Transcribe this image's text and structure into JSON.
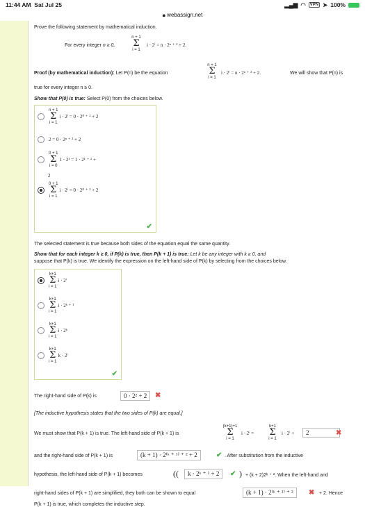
{
  "status": {
    "time": "11:44 AM",
    "date": "Sat Jul 25",
    "battery": "100%",
    "vpn": "VPN"
  },
  "url": "webassign.net",
  "prompt": "Prove the following statement by mathematical induction.",
  "statement": {
    "intro": "For every integer",
    "cond": "n ≥ 0,",
    "sum_top": "n + 1",
    "sum_bot": "i = 1",
    "body": "i · 2ⁱ = n · 2ⁿ ⁺ ² + 2."
  },
  "proof": {
    "heading": "Proof (by mathematical induction):",
    "text1": "Let P(n) be the equation",
    "eq": "i · 2ⁱ = n · 2ⁿ ⁺ ² + 2.",
    "text2": "We will show that P(n) is",
    "line2": "true for every integer n ≥ 0."
  },
  "p0": {
    "heading": "Show that P(0) is true:",
    "text": "Select P(0) from the choices below."
  },
  "p0_options": [
    {
      "top": "n + 1",
      "bot": "i = 1",
      "expr": "i · 2ⁱ = 0 · 2⁰ ⁺ ² + 2"
    },
    {
      "expr": "2 = 0 · 2ⁿ ⁺ ² + 2"
    },
    {
      "top": "0 + 1",
      "bot": "i = 0",
      "expr": "1 · 2¹ = 1 · 2¹ ⁺ ² +",
      "extra": "2"
    },
    {
      "top": "0 + 1",
      "bot": "i = 1",
      "expr": "i · 2ⁱ = 0 · 2⁰ ⁺ ² + 2"
    }
  ],
  "truth": "The selected statement is true because both sides of the equation equal the same quantity.",
  "pk": {
    "heading": "Show that for each integer k ≥ 0, if P(k) is true, then P(k + 1) is true:",
    "text": "Let k be any integer with k ≥ 0, and",
    "line2": "suppose that P(k) is true. We identify the expression on the left-hand side of P(k) by selecting from the choices below."
  },
  "pk_options": [
    {
      "top": "k+1",
      "bot": "i = 1",
      "expr": "i · 2ⁱ"
    },
    {
      "top": "k+1",
      "bot": "i = 1",
      "expr": "i · 2ᵏ ⁺ ¹"
    },
    {
      "top": "k+1",
      "bot": "i = 1",
      "expr": "i · 2ᵏ"
    },
    {
      "top": "k+1",
      "bot": "i = 1",
      "expr": "k · 2ⁱ"
    }
  ],
  "rhs": {
    "label": "The right-hand side of P(k) is",
    "value": "0 · 2² + 2"
  },
  "hypothesis": "[The inductive hypothesis states that the two sides of P(k) are equal.]",
  "lhs_line": {
    "text": "We must show that P(k + 1) is true. The left-hand side of P(k + 1) is",
    "top1": "(k+1)+1",
    "bot1": "i = 1",
    "mid": "i · 2ⁱ =",
    "top2": "k+1",
    "bot2": "i = 1",
    "tail": "i · 2ⁱ +",
    "answer": "2"
  },
  "rhs_line": {
    "text": "and the right-hand side of P(k + 1) is",
    "answer": "(k + 1) · 2⁽ᵏ ⁺ ¹⁾ ⁺ ² + 2",
    "after": ". After substitution from the inductive"
  },
  "hyp_line": {
    "text": "hypothesis, the left-hand side of P(k + 1) becomes",
    "answer": "k · 2ᵏ ⁺ ² + 2",
    "after": "+ (k + 2)2ᵏ ⁺ ². When the left-hand and"
  },
  "final_line": {
    "text": "right-hand sides of P(k + 1) are simplified, they both can be shown to equal",
    "answer": "(k + 1) · 2⁽ᵏ ⁺ ¹⁾ ⁺ ²",
    "after": "+ 2. Hence"
  },
  "last_line": "P(k + 1) is true, which completes the inductive step.",
  "colors": {
    "correct": "#4caf50",
    "incorrect": "#d9534f",
    "frame": "#f4f9d2",
    "battery": "#34c759"
  }
}
